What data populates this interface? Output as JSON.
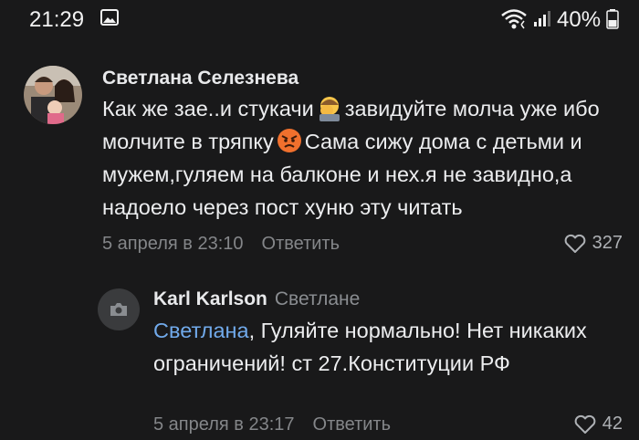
{
  "status_bar": {
    "time": "21:29",
    "battery": "40%",
    "icons": [
      "gallery-icon",
      "wifi-icon",
      "signal-icon",
      "battery-icon"
    ]
  },
  "comments": [
    {
      "author": "Светлана Селезнева",
      "text_parts": {
        "p1": "Как же зае..и стукачи",
        "emoji1": "face-palm-emoji",
        "p2": "завидуйте молча уже ибо молчите в тряпку",
        "emoji2": "angry-face-emoji",
        "p3": "Сама сижу дома с детьми и мужем,гуляем на балконе и нех.я не завидно,а надоело через пост хуню эту читать"
      },
      "date": "5 апреля в 23:10",
      "reply_label": "Ответить",
      "likes": "327"
    },
    {
      "author": "Karl Karlson",
      "reply_to": "Светлане",
      "mention": "Светлана",
      "text": ", Гуляйте нормально!  Нет никаких ограничений!  ст 27.Конституции РФ",
      "date": "5 апреля в 23:17",
      "reply_label": "Ответить",
      "likes": "42"
    }
  ],
  "colors": {
    "background": "#19191a",
    "mention": "#71aaeb",
    "secondary_text": "#848689"
  }
}
